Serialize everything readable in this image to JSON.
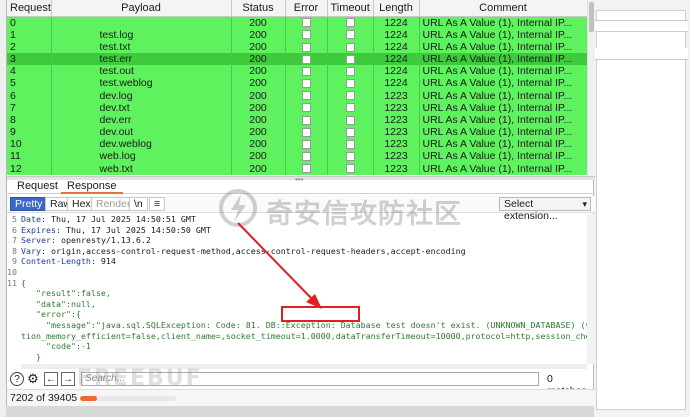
{
  "table": {
    "columns": [
      "Request",
      "Payload",
      "Status",
      "Error",
      "Timeout",
      "Length",
      "Comment"
    ],
    "rows": [
      {
        "request": "0",
        "payload": "",
        "status": "200",
        "length": "1224",
        "comment": "URL As A Value (1), Internal IP..."
      },
      {
        "request": "1",
        "payload": "test.log",
        "status": "200",
        "length": "1224",
        "comment": "URL As A Value (1), Internal IP..."
      },
      {
        "request": "2",
        "payload": "test.txt",
        "status": "200",
        "length": "1224",
        "comment": "URL As A Value (1), Internal IP..."
      },
      {
        "request": "3",
        "payload": "test.err",
        "status": "200",
        "length": "1224",
        "comment": "URL As A Value (1), Internal IP..."
      },
      {
        "request": "4",
        "payload": "test.out",
        "status": "200",
        "length": "1224",
        "comment": "URL As A Value (1), Internal IP..."
      },
      {
        "request": "5",
        "payload": "test.weblog",
        "status": "200",
        "length": "1224",
        "comment": "URL As A Value (1), Internal IP..."
      },
      {
        "request": "6",
        "payload": "dev.log",
        "status": "200",
        "length": "1223",
        "comment": "URL As A Value (1), Internal IP..."
      },
      {
        "request": "7",
        "payload": "dev.txt",
        "status": "200",
        "length": "1223",
        "comment": "URL As A Value (1), Internal IP..."
      },
      {
        "request": "8",
        "payload": "dev.err",
        "status": "200",
        "length": "1223",
        "comment": "URL As A Value (1), Internal IP..."
      },
      {
        "request": "9",
        "payload": "dev.out",
        "status": "200",
        "length": "1223",
        "comment": "URL As A Value (1), Internal IP..."
      },
      {
        "request": "10",
        "payload": "dev.weblog",
        "status": "200",
        "length": "1223",
        "comment": "URL As A Value (1), Internal IP..."
      },
      {
        "request": "11",
        "payload": "web.log",
        "status": "200",
        "length": "1223",
        "comment": "URL As A Value (1), Internal IP..."
      },
      {
        "request": "12",
        "payload": "web.txt",
        "status": "200",
        "length": "1223",
        "comment": "URL As A Value (1), Internal IP..."
      }
    ]
  },
  "tabs": {
    "request": "Request",
    "response": "Response"
  },
  "toolbar": {
    "pretty": "Pretty",
    "raw": "Raw",
    "hex": "Hex",
    "render": "Render",
    "newline": "\\n",
    "menu": "≡",
    "extension": "Select extension..."
  },
  "response_lines": [
    {
      "no": "5",
      "key": "Date",
      "val": " Thu, 17 Jul 2025 14:50:51 GMT"
    },
    {
      "no": "6",
      "key": "Expires",
      "val": " Thu, 17 Jul 2025 14:50:50 GMT"
    },
    {
      "no": "7",
      "key": "Server",
      "val": " openresty/1.13.6.2"
    },
    {
      "no": "8",
      "key": "Vary",
      "val": " origin,access-control-request-method,access-control-request-headers,accept-encoding"
    },
    {
      "no": "9",
      "key": "Content-Length",
      "val": " 914"
    },
    {
      "no": "10",
      "key": "",
      "val": ""
    },
    {
      "no": "11",
      "key": "",
      "val": "{"
    },
    {
      "no": "",
      "key": "",
      "val": "   \"result\":false,"
    },
    {
      "no": "",
      "key": "",
      "val": "   \"data\":null,"
    },
    {
      "no": "",
      "key": "",
      "val": "   \"error\":{"
    },
    {
      "no": "",
      "key": "",
      "val": "     \"message\":\"java.sql.SQLException: Code: 81. DB::Exception: Database test doesn't exist. (UNKNOWN_DATABASE) (version 22.8.2.11 (o"
    },
    {
      "no": "",
      "key": "",
      "val": "tion_memory_efficient=false,client_name=,socket_timeout=1.0000,dataTransferTimeout=10000,protocol=http,session_check=false,path="
    },
    {
      "no": "",
      "key": "",
      "val": "     \"code\":-1"
    },
    {
      "no": "",
      "key": "",
      "val": "   }"
    },
    {
      "no": "",
      "key": "",
      "val": "}"
    }
  ],
  "search": {
    "placeholder": "Search...",
    "matches": "0 matches"
  },
  "status": {
    "count": "7202 of 39405",
    "progress": 0.18
  },
  "watermark": {
    "text": "奇安信攻防社区",
    "text2": "FREEBUF"
  },
  "colors": {
    "row": "#5ef25e",
    "selected_row": "#3dcb3d",
    "accent": "#f26a2b",
    "highlight": "#e02020"
  }
}
